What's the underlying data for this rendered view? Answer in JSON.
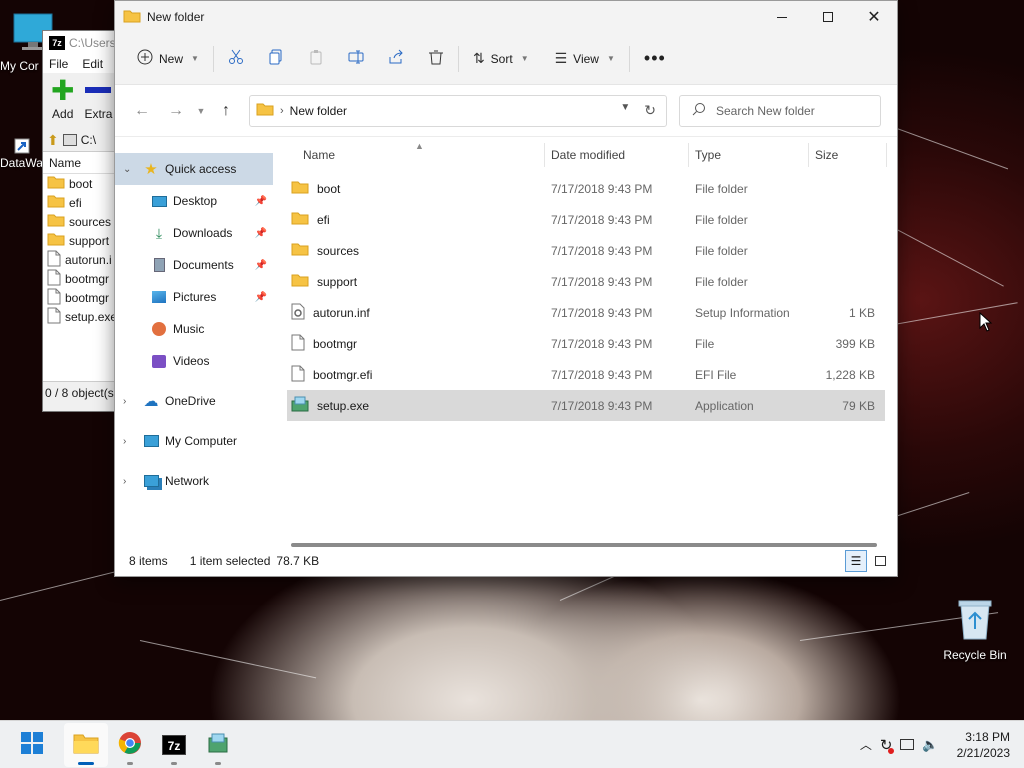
{
  "desktop": {
    "icons": [
      {
        "label": "My Cor"
      },
      {
        "label": "DataWa"
      },
      {
        "label": "Recycle Bin"
      }
    ]
  },
  "zip": {
    "title": "C:\\Users",
    "menu": [
      "File",
      "Edit"
    ],
    "tools": [
      "Add",
      "Extra"
    ],
    "address": "C:\\",
    "column": "Name",
    "items": [
      "boot",
      "efi",
      "sources",
      "support",
      "autorun.i",
      "bootmgr",
      "bootmgr",
      "setup.exe"
    ],
    "status": "0 / 8 object(s)"
  },
  "explorer": {
    "title": "New folder",
    "commands": {
      "new": "New",
      "sort": "Sort",
      "view": "View"
    },
    "address": "New folder",
    "search_placeholder": "Search New folder",
    "nav": {
      "quick_access": "Quick access",
      "pinned": [
        "Desktop",
        "Downloads",
        "Documents",
        "Pictures"
      ],
      "others": [
        "Music",
        "Videos"
      ],
      "onedrive": "OneDrive",
      "my_computer": "My Computer",
      "network": "Network"
    },
    "columns": {
      "name": "Name",
      "date": "Date modified",
      "type": "Type",
      "size": "Size"
    },
    "files": [
      {
        "name": "boot",
        "date": "7/17/2018 9:43 PM",
        "type": "File folder",
        "size": "",
        "icon": "folder-icon"
      },
      {
        "name": "efi",
        "date": "7/17/2018 9:43 PM",
        "type": "File folder",
        "size": "",
        "icon": "folder-icon"
      },
      {
        "name": "sources",
        "date": "7/17/2018 9:43 PM",
        "type": "File folder",
        "size": "",
        "icon": "folder-icon"
      },
      {
        "name": "support",
        "date": "7/17/2018 9:43 PM",
        "type": "File folder",
        "size": "",
        "icon": "folder-icon"
      },
      {
        "name": "autorun.inf",
        "date": "7/17/2018 9:43 PM",
        "type": "Setup Information",
        "size": "1 KB",
        "icon": "settings-file-icon"
      },
      {
        "name": "bootmgr",
        "date": "7/17/2018 9:43 PM",
        "type": "File",
        "size": "399 KB",
        "icon": "file-icon"
      },
      {
        "name": "bootmgr.efi",
        "date": "7/17/2018 9:43 PM",
        "type": "EFI File",
        "size": "1,228 KB",
        "icon": "file-icon"
      },
      {
        "name": "setup.exe",
        "date": "7/17/2018 9:43 PM",
        "type": "Application",
        "size": "79 KB",
        "icon": "setup-app-icon",
        "selected": true
      }
    ],
    "status": {
      "count": "8 items",
      "selection": "1 item selected",
      "size": "78.7 KB"
    }
  },
  "taskbar": {
    "time": "3:18 PM",
    "date": "2/21/2023"
  },
  "colors": {
    "accent": "#005fb8",
    "folder": "#f6c344",
    "selection": "#d9d9d9",
    "nav_selected": "#ccd9e6"
  }
}
